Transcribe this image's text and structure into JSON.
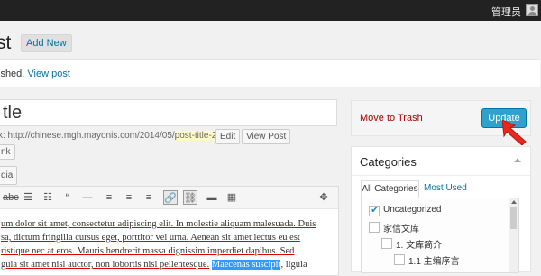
{
  "adminbar": {
    "user_name": "管理员"
  },
  "header": {
    "title_fragment": "st",
    "add_new_label": "Add New"
  },
  "notice": {
    "text_fragment": "ished. ",
    "link_label": "View post"
  },
  "post": {
    "title_value": "tle",
    "permalink_prefix": "k: http://chinese.mgh.mayonis.com/2014/05/",
    "permalink_slug": "post-title-2",
    "permalink_suffix": "/",
    "edit_button": "Edit",
    "view_post_button": "View Post",
    "link_fragment": "nk",
    "media_fragment": "dia"
  },
  "editor": {
    "toolbar_icons": [
      "strikethrough-icon",
      "bullet-list-icon",
      "numbered-list-icon",
      "blockquote-icon",
      "horizontal-rule-icon",
      "align-left-icon",
      "align-center-icon",
      "align-right-icon",
      "insert-link-icon",
      "remove-link-icon",
      "read-more-icon",
      "toolbar-toggle-icon",
      "fullscreen-icon"
    ],
    "lines": [
      "um dolor sit amet, consectetur adipiscing elit. In molestie aliquam malesuada. Duis",
      "sa, dictum fringilla cursus eget, porttitor vel urna. Aenean sit amet lectus eu est",
      "ristique nec at eros. Mauris hendrerit massa dignissim imperdiet dapibus. Sed",
      "gula sit amet nisl auctor, non lobortis nisl pellentesque.",
      "Maecenas suscipit",
      ", ligula"
    ]
  },
  "publish": {
    "trash_label": "Move to Trash",
    "update_label": "Update"
  },
  "categories": {
    "title": "Categories",
    "tab_all": "All Categories",
    "tab_used": "Most Used",
    "items": [
      {
        "label": "Uncategorized",
        "checked": true
      },
      {
        "label": "家信文库",
        "checked": false
      },
      {
        "label": "1. 文库简介",
        "checked": false
      },
      {
        "label": "1.1 主编序言",
        "checked": false
      }
    ]
  },
  "colors": {
    "primary_button": "#2ea2cc",
    "link": "#0074a2",
    "trash": "#a00",
    "adminbar": "#222222",
    "arrow": "#e8281c"
  }
}
